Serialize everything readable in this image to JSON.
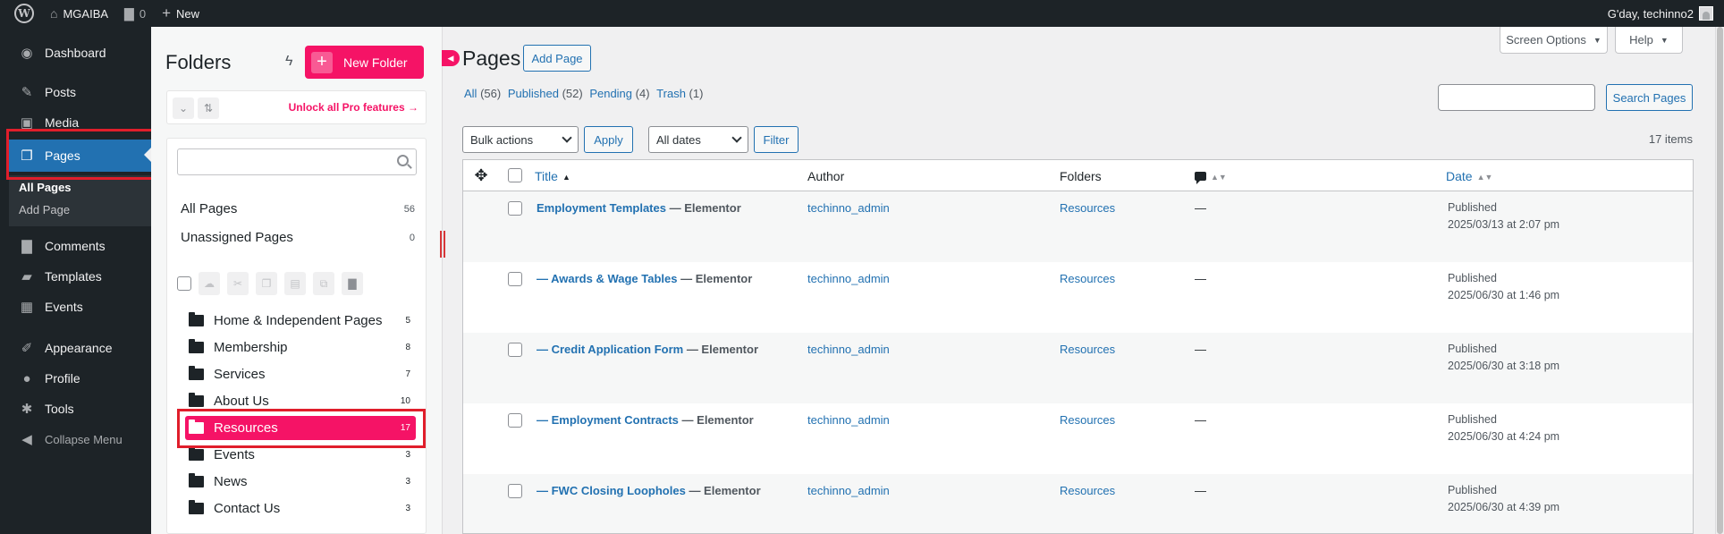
{
  "adminbar": {
    "site_name": "MGAIBA",
    "comments_count": "0",
    "new_label": "New",
    "greeting": "G'day, techinno2"
  },
  "menu": {
    "dashboard": "Dashboard",
    "posts": "Posts",
    "media": "Media",
    "pages": "Pages",
    "all_pages": "All Pages",
    "add_page": "Add Page",
    "comments": "Comments",
    "templates": "Templates",
    "events": "Events",
    "appearance": "Appearance",
    "profile": "Profile",
    "tools": "Tools",
    "collapse": "Collapse Menu"
  },
  "folders": {
    "title": "Folders",
    "new_folder_label": "New Folder",
    "unlock_label": "Unlock all Pro features →",
    "all_pages_label": "All Pages",
    "all_pages_count": "56",
    "unassigned_label": "Unassigned Pages",
    "unassigned_count": "0",
    "items": [
      {
        "label": "Home & Independent Pages",
        "count": "5"
      },
      {
        "label": "Membership",
        "count": "8"
      },
      {
        "label": "Services",
        "count": "7"
      },
      {
        "label": "About Us",
        "count": "10"
      },
      {
        "label": "Resources",
        "count": "17"
      },
      {
        "label": "Events",
        "count": "3"
      },
      {
        "label": "News",
        "count": "3"
      },
      {
        "label": "Contact Us",
        "count": "3"
      }
    ]
  },
  "main": {
    "title": "Pages",
    "add_page_label": "Add Page",
    "screen_options_label": "Screen Options",
    "help_label": "Help",
    "filters": {
      "all": "All",
      "all_count": "(56)",
      "published": "Published",
      "published_count": "(52)",
      "pending": "Pending",
      "pending_count": "(4)",
      "trash": "Trash",
      "trash_count": "(1)"
    },
    "search_button": "Search Pages",
    "bulk_actions": "Bulk actions",
    "apply_label": "Apply",
    "all_dates": "All dates",
    "filter_label": "Filter",
    "items_count": "17 items",
    "columns": {
      "title": "Title",
      "author": "Author",
      "folders": "Folders",
      "date": "Date"
    },
    "rows": [
      {
        "title": "Employment Templates",
        "state": " — Elementor",
        "author": "techinno_admin",
        "folder": "Resources",
        "comments": "—",
        "status": "Published",
        "date": "2025/03/13 at 2:07 pm"
      },
      {
        "title": "— Awards & Wage Tables",
        "state": " — Elementor",
        "author": "techinno_admin",
        "folder": "Resources",
        "comments": "—",
        "status": "Published",
        "date": "2025/06/30 at 1:46 pm"
      },
      {
        "title": "— Credit Application Form",
        "state": " — Elementor",
        "author": "techinno_admin",
        "folder": "Resources",
        "comments": "—",
        "status": "Published",
        "date": "2025/06/30 at 3:18 pm"
      },
      {
        "title": "— Employment Contracts",
        "state": " — Elementor",
        "author": "techinno_admin",
        "folder": "Resources",
        "comments": "—",
        "status": "Published",
        "date": "2025/06/30 at 4:24 pm"
      },
      {
        "title": "— FWC Closing Loopholes",
        "state": " — Elementor",
        "author": "techinno_admin",
        "folder": "Resources",
        "comments": "—",
        "status": "Published",
        "date": "2025/06/30 at 4:39 pm"
      }
    ]
  },
  "colors": {
    "wp_blue": "#2271b1",
    "folders_pink": "#f51366",
    "admin_dark": "#1d2327",
    "highlight_red": "#e01e2b"
  }
}
